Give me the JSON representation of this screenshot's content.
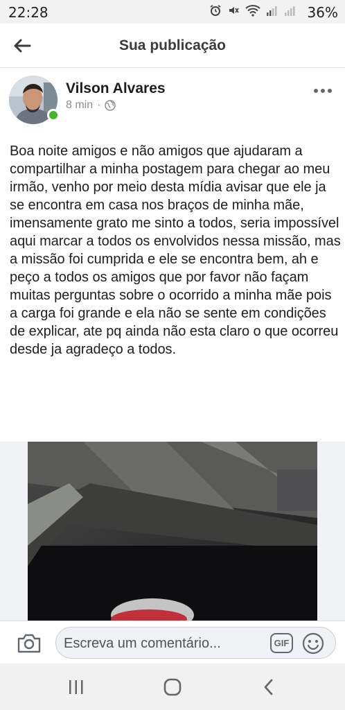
{
  "status_bar": {
    "time": "22:28",
    "battery": "36%",
    "icons": [
      "alarm-icon",
      "mute-icon",
      "wifi-icon",
      "signal-icon",
      "signal-icon-2",
      "battery-icon"
    ]
  },
  "header": {
    "title": "Sua publicação",
    "back_icon": "arrow-left-icon"
  },
  "post": {
    "author": "Vilson Alvares",
    "time_ago": "8 min",
    "separator": "·",
    "privacy_icon": "globe-icon",
    "online": true,
    "text": "Boa noite amigos e não amigos que ajudaram a compartilhar a minha postagem para chegar ao meu irmão, venho por meio desta mídia avisar que ele ja se encontra em casa nos braços de minha mãe, imensamente grato me sinto a todos, seria impossível aqui marcar a todos os envolvidos nessa missão, mas a missão foi cumprida e ele se encontra bem, ah e peço a todos os amigos que por favor não façam muitas perguntas sobre o ocorrido a minha mãe pois a carga foi grande e ela não se sente em condições de explicar, ate pq ainda não esta claro o que ocorreu desde ja agradeço a todos.",
    "more_icon": "more-horizontal-icon"
  },
  "comment_bar": {
    "placeholder": "Escreva um comentário...",
    "gif_label": "GIF",
    "camera_icon": "camera-icon",
    "emoji_icon": "smiley-icon"
  },
  "nav_bar": {
    "icons": [
      "recent-apps-icon",
      "home-icon",
      "back-icon"
    ]
  },
  "colors": {
    "online": "#42b72a",
    "text": "#1c1e21",
    "meta": "#8a8d91"
  }
}
